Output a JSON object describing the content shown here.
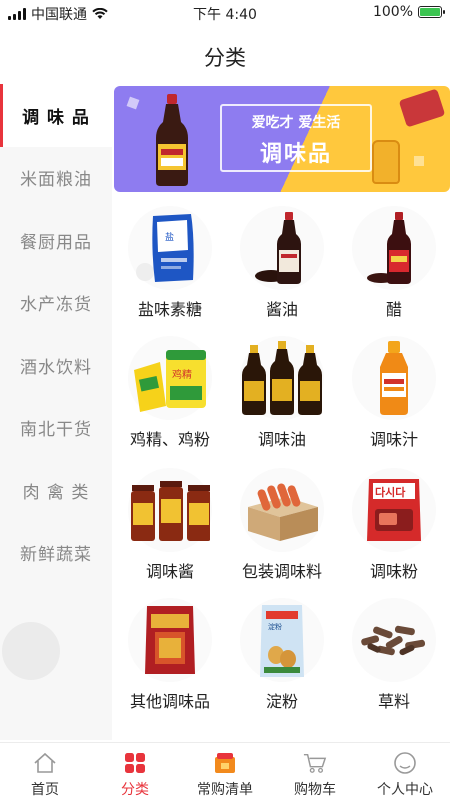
{
  "status": {
    "carrier": "中国联通",
    "time": "下午 4:40",
    "battery_percent": "100%"
  },
  "nav": {
    "title": "分类"
  },
  "sidebar": {
    "items": [
      {
        "label": "调 味 品"
      },
      {
        "label": "米面粮油"
      },
      {
        "label": "餐厨用品"
      },
      {
        "label": "水产冻货"
      },
      {
        "label": "酒水饮料"
      },
      {
        "label": "南北干货"
      },
      {
        "label": "肉 禽 类"
      },
      {
        "label": "新鲜蔬菜"
      }
    ],
    "active_index": 0
  },
  "banner": {
    "line1": "爱吃才 爱生活",
    "line2": "调味品"
  },
  "products": [
    {
      "label": "盐味素糖",
      "icon": "salt-bag-icon"
    },
    {
      "label": "酱油",
      "icon": "soy-sauce-icon"
    },
    {
      "label": "醋",
      "icon": "vinegar-icon"
    },
    {
      "label": "鸡精、鸡粉",
      "icon": "chicken-essence-icon"
    },
    {
      "label": "调味油",
      "icon": "seasoning-oil-icon"
    },
    {
      "label": "调味汁",
      "icon": "seasoning-juice-icon"
    },
    {
      "label": "调味酱",
      "icon": "seasoning-paste-icon"
    },
    {
      "label": "包装调味料",
      "icon": "packaged-seasoning-icon"
    },
    {
      "label": "调味粉",
      "icon": "seasoning-powder-icon"
    },
    {
      "label": "其他调味品",
      "icon": "other-seasoning-icon"
    },
    {
      "label": "淀粉",
      "icon": "starch-icon"
    },
    {
      "label": "草料",
      "icon": "herbs-icon"
    }
  ],
  "tabbar": {
    "items": [
      {
        "label": "首页",
        "icon": "home-icon"
      },
      {
        "label": "分类",
        "icon": "category-icon"
      },
      {
        "label": "常购清单",
        "icon": "shopping-list-icon"
      },
      {
        "label": "购物车",
        "icon": "cart-icon"
      },
      {
        "label": "个人中心",
        "icon": "profile-icon"
      }
    ],
    "active_index": 1
  },
  "colors": {
    "accent": "#e8343c",
    "banner_purple": "#8e7cf0",
    "banner_yellow": "#ffc83d",
    "battery_green": "#3cc552"
  }
}
